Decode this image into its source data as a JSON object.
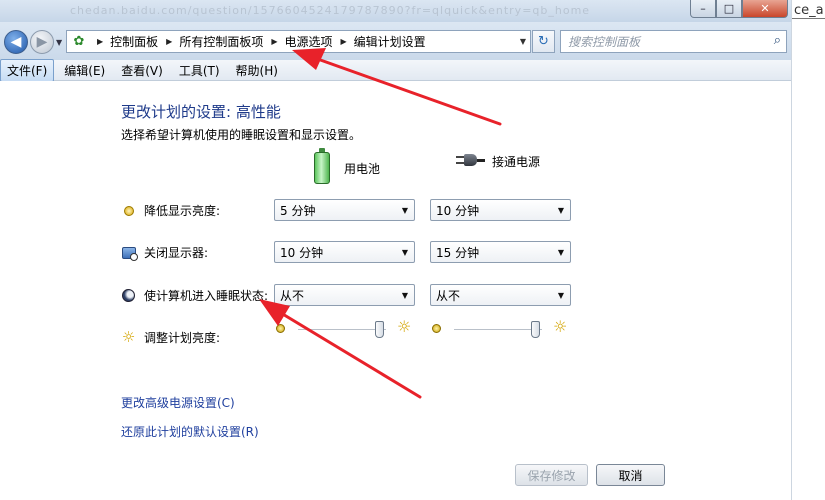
{
  "window": {
    "blurred_url": "chedan.baidu.com/question/1576604524179787890?fr=qlquick&entry=qb_home",
    "minimize_label": "–",
    "maximize_label": "□",
    "close_label": "✕",
    "side_text": "ce_a"
  },
  "address": {
    "breadcrumbs": [
      "控制面板",
      "所有控制面板项",
      "电源选项",
      "编辑计划设置"
    ],
    "search_placeholder": "搜索控制面板"
  },
  "menu": {
    "items": [
      "文件(F)",
      "编辑(E)",
      "查看(V)",
      "工具(T)",
      "帮助(H)"
    ]
  },
  "main": {
    "title": "更改计划的设置: 高性能",
    "subtitle": "选择希望计算机使用的睡眠设置和显示设置。",
    "col_battery": "用电池",
    "col_plugged": "接通电源",
    "rows": {
      "dim": {
        "label": "降低显示亮度:",
        "battery": "5 分钟",
        "plugged": "10 分钟"
      },
      "display_off": {
        "label": "关闭显示器:",
        "battery": "10 分钟",
        "plugged": "15 分钟"
      },
      "sleep": {
        "label": "使计算机进入睡眠状态:",
        "battery": "从不",
        "plugged": "从不"
      },
      "brightness": {
        "label": "调整计划亮度:",
        "battery_level": 0.93,
        "plugged_level": 0.93
      }
    },
    "link_advanced": "更改高级电源设置(C)",
    "link_restore": "还原此计划的默认设置(R)"
  },
  "footer": {
    "save_label": "保存修改",
    "cancel_label": "取消"
  },
  "colors": {
    "title_blue": "#1e3a8a",
    "link_blue": "#1f3f9e",
    "annotation_red": "#e8222a"
  }
}
